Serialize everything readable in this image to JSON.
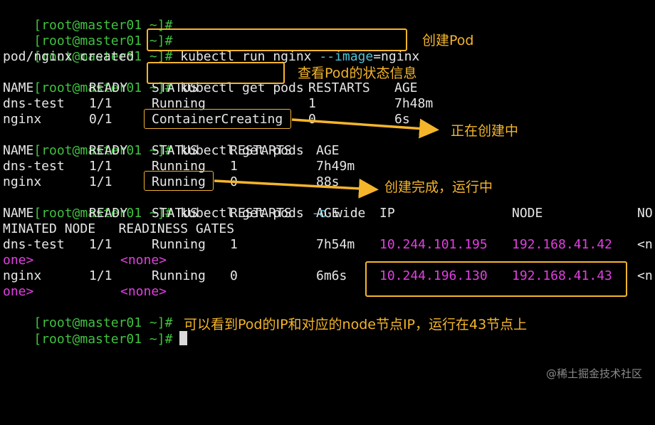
{
  "terminal": {
    "prompt": "[root@master01 ~]#",
    "lines": {
      "l0_cmd": "",
      "l1_cmd": "",
      "l2_cmd_kubectl": "kubectl run nginx ",
      "l2_cmd_flag": "--image",
      "l2_cmd_eq": "=nginx",
      "l3_out": "pod/nginx created",
      "l4_cmd": "kubectl get pods",
      "t1_header": [
        "NAME",
        "READY",
        "STATUS",
        "RESTARTS",
        "AGE"
      ],
      "t1_row1": [
        "dns-test",
        "1/1",
        "Running",
        "1",
        "7h48m"
      ],
      "t1_row2": [
        "nginx",
        "0/1",
        "ContainerCreating",
        "0",
        "6s"
      ],
      "l8_cmd": "kubectl get pods",
      "t2_header": [
        "NAME",
        "READY",
        "STATUS",
        "RESTARTS",
        "AGE"
      ],
      "t2_row1": [
        "dns-test",
        "1/1",
        "Running",
        "1",
        "7h49m"
      ],
      "t2_row2": [
        "nginx",
        "1/1",
        "Running",
        "0",
        "88s"
      ],
      "l12_cmd_a": "kubectl get pods ",
      "l12_cmd_flag": "-o",
      "l12_cmd_b": " wide",
      "t3_header": [
        "NAME",
        "READY",
        "STATUS",
        "RESTARTS",
        "AGE",
        "IP",
        "NODE",
        "NO"
      ],
      "t3_header_wrap": "MINATED NODE   READINESS GATES",
      "t3_row1": [
        "dns-test",
        "1/1",
        "Running",
        "1",
        "7h54m",
        "10.244.101.195",
        "192.168.41.42",
        "<n"
      ],
      "t3_row1_wrap_a": "one>",
      "t3_row1_wrap_b": "<none>",
      "t3_row2": [
        "nginx",
        "1/1",
        "Running",
        "0",
        "6m6s",
        "10.244.196.130",
        "192.168.41.43",
        "<n"
      ],
      "t3_row2_wrap_a": "one>",
      "t3_row2_wrap_b": "<none>",
      "l19_cmd": "",
      "l20_cmd": ""
    }
  },
  "annotations": {
    "create_pod": "创建Pod",
    "view_status": "查看Pod的状态信息",
    "creating": "正在创建中",
    "created_running": "创建完成，运行中",
    "ip_note": "可以看到Pod的IP和对应的node节点IP，运行在43节点上"
  },
  "watermark": "@稀土掘金技术社区",
  "colors": {
    "background": "#000000",
    "prompt": "#3fc33f",
    "flag": "#4fc3d9",
    "ip": "#e040e0",
    "annotation": "#f5b52b"
  }
}
